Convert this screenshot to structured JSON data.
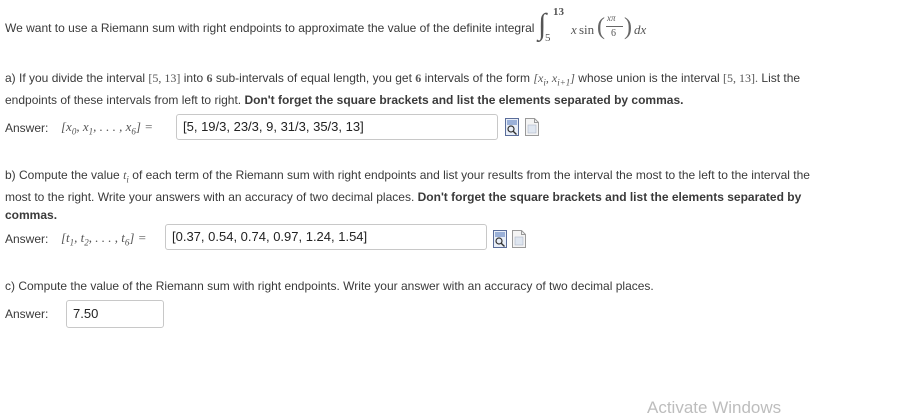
{
  "intro": {
    "text": "We want to use a Riemann sum with right endpoints to approximate the value of the definite integral",
    "integral": {
      "lower": "5",
      "upper": "13",
      "integrand_x": "x",
      "func": "sin",
      "num": "xπ",
      "den": "6",
      "dx": "dx"
    }
  },
  "part_a": {
    "line1_pre": "a) If you divide the interval",
    "interval": "[5, 13]",
    "line1_into": "into",
    "n": "6",
    "line1_mid": "sub-intervals of equal length, you get",
    "n2": "6",
    "line1_form": "intervals of the form",
    "form": "[x",
    "form_sub1": "i",
    "form_comma": ", x",
    "form_sub2": "i+1",
    "form_close": "]",
    "line1_union": "whose union is the interval",
    "interval2": "[5, 13]",
    "period": ".",
    "line1_end": "List the",
    "line2_normal": "endpoints of these intervals from left to right.",
    "line2_bold": "Don't forget the square brackets and list the elements separated by commas.",
    "answer_label": "Answer:",
    "answer_math": "[x",
    "answer_math_sub0": "0",
    "answer_math_mid": ", x",
    "answer_math_sub1": "1",
    "answer_math_dots": ", . . . , x",
    "answer_math_sub6": "6",
    "answer_math_end": "] =",
    "answer_value": "[5, 19/3, 23/3, 9, 31/3, 35/3, 13]"
  },
  "part_b": {
    "line1_pre": "b) Compute the value",
    "t": "t",
    "t_sub": "i",
    "line1_rest": "of each term of the Riemann sum with right endpoints and list your results from the interval the most to the left to the interval the",
    "line2_normal": "most to the right. Write your answers with an accuracy of two decimal places.",
    "line2_bold": "Don't forget the square brackets and list the elements separated by",
    "line3_bold": "commas.",
    "answer_label": "Answer:",
    "answer_math": "[t",
    "answer_math_sub1": "1",
    "answer_math_mid": ", t",
    "answer_math_sub2": "2",
    "answer_math_dots": ", . . . , t",
    "answer_math_sub6": "6",
    "answer_math_end": "] =",
    "answer_value": "[0.37, 0.54, 0.74, 0.97, 1.24, 1.54]"
  },
  "part_c": {
    "line1": "c) Compute the value of the Riemann sum with right endpoints. Write your answer with an accuracy of two decimal places.",
    "answer_label": "Answer:",
    "answer_value": "7.50"
  },
  "watermark": "Activate Windows",
  "icons": {
    "preview": "formula-preview-icon",
    "help": "help-page-icon"
  }
}
